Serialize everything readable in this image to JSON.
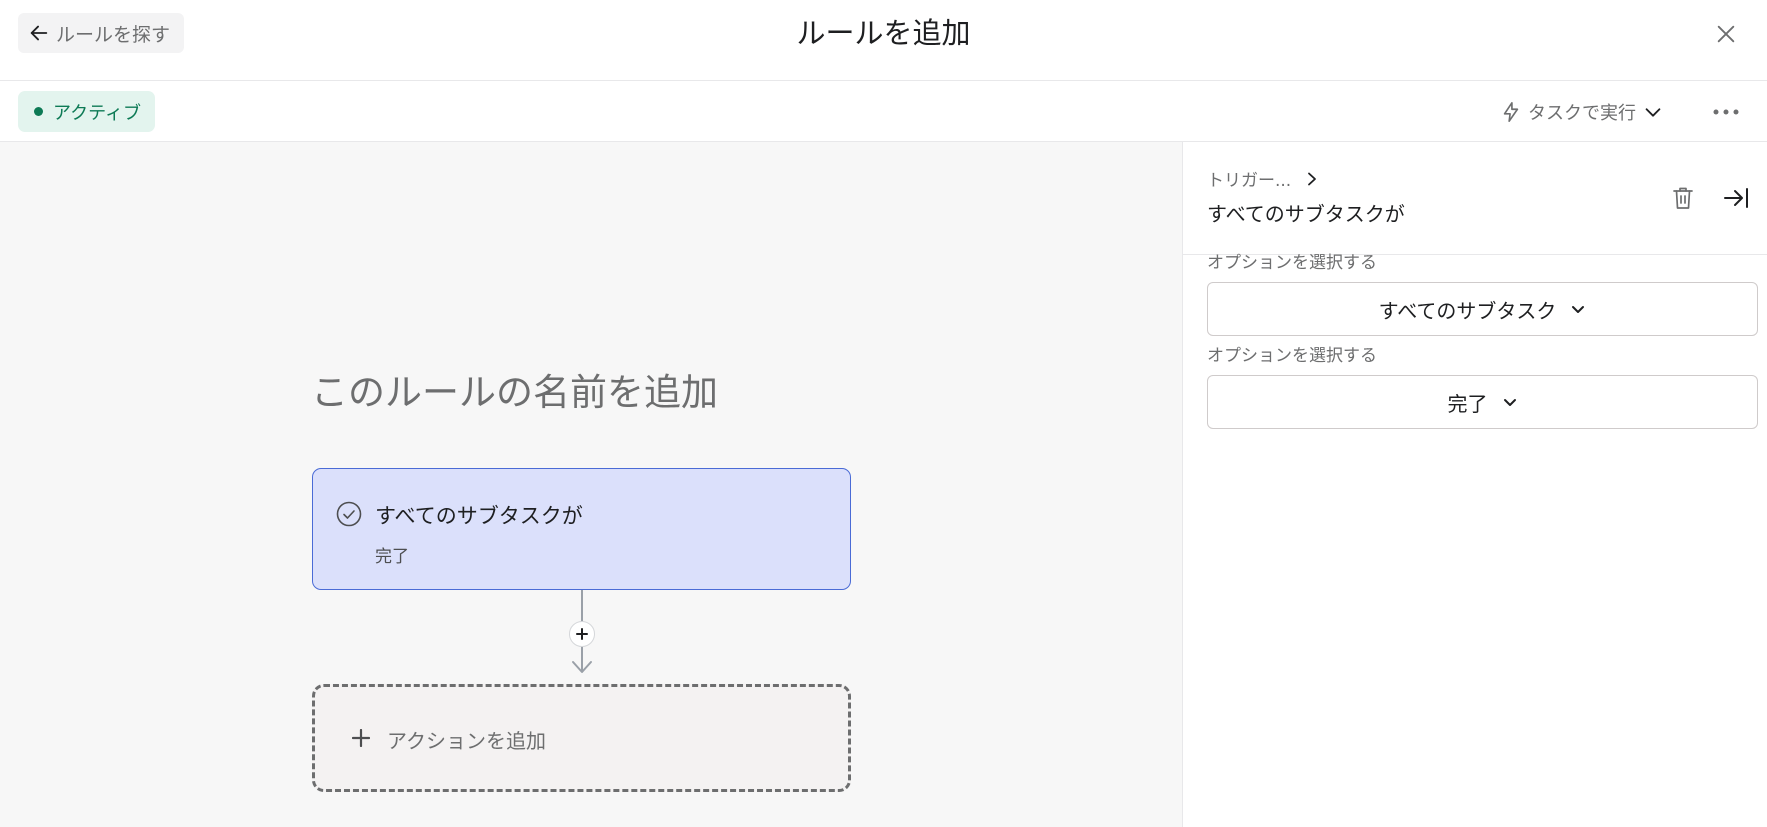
{
  "header": {
    "back_label": "ルールを探す",
    "title": "ルールを追加"
  },
  "toolbar": {
    "status_label": "アクティブ",
    "run_label": "タスクで実行"
  },
  "canvas": {
    "rule_name_placeholder": "このルールの名前を追加",
    "trigger": {
      "title": "すべてのサブタスクが",
      "subtitle": "完了"
    },
    "add_action_label": "アクションを追加"
  },
  "panel": {
    "breadcrumb": "トリガー...",
    "title": "すべてのサブタスクが",
    "options": [
      {
        "label": "オプションを選択する",
        "value": "すべてのサブタスク"
      },
      {
        "label": "オプションを選択する",
        "value": "完了"
      }
    ]
  },
  "colors": {
    "status_green": "#0d7a55",
    "status_bg": "#e3f4ee",
    "trigger_bg": "#dbe0fb",
    "trigger_border": "#4a6bd6",
    "canvas_bg": "#f7f7f7"
  },
  "icons": [
    "arrow-left-icon",
    "close-icon",
    "status-dot-icon",
    "lightning-icon",
    "chevron-down-icon",
    "more-icon",
    "check-circle-icon",
    "plus-icon",
    "arrow-down-icon",
    "chevron-right-icon",
    "trash-icon",
    "collapse-panel-icon"
  ]
}
